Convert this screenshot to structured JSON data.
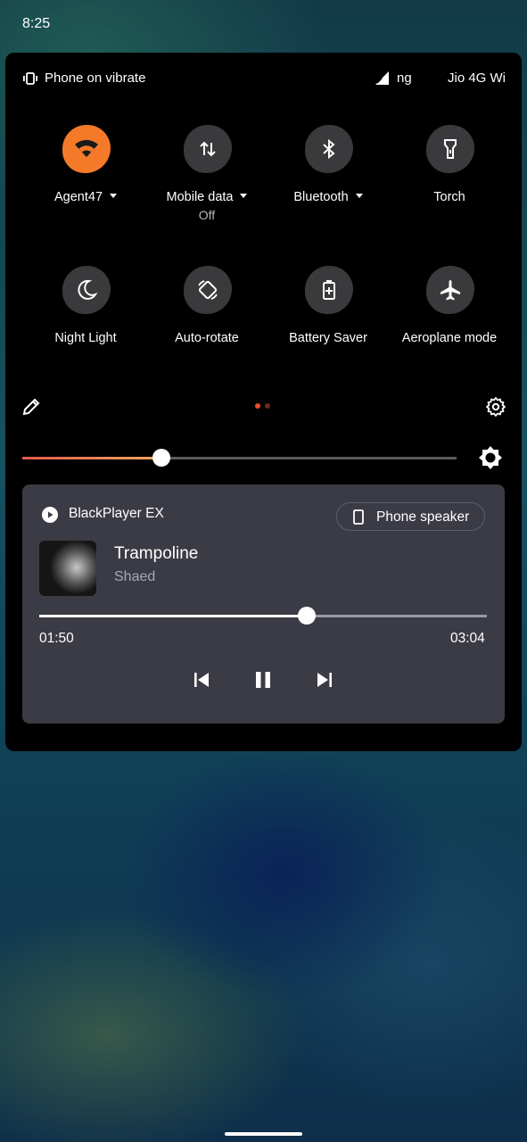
{
  "status_bar": {
    "time": "8:25"
  },
  "panel_header": {
    "ringer_label": "Phone on vibrate",
    "signal_text": "ng",
    "carrier": "Jio 4G Wi"
  },
  "tiles": [
    {
      "label": "Agent47",
      "sub": "",
      "has_dropdown": true,
      "active": true,
      "icon": "wifi-icon"
    },
    {
      "label": "Mobile data",
      "sub": "Off",
      "has_dropdown": true,
      "active": false,
      "icon": "mobile-data-icon"
    },
    {
      "label": "Bluetooth",
      "sub": "",
      "has_dropdown": true,
      "active": false,
      "icon": "bluetooth-icon"
    },
    {
      "label": "Torch",
      "sub": "",
      "has_dropdown": false,
      "active": false,
      "icon": "torch-icon"
    },
    {
      "label": "Night Light",
      "sub": "",
      "has_dropdown": false,
      "active": false,
      "icon": "moon-icon"
    },
    {
      "label": "Auto-rotate",
      "sub": "",
      "has_dropdown": false,
      "active": false,
      "icon": "rotate-icon"
    },
    {
      "label": "Battery Saver",
      "sub": "",
      "has_dropdown": false,
      "active": false,
      "icon": "battery-icon"
    },
    {
      "label": "Aeroplane mode",
      "sub": "",
      "has_dropdown": false,
      "active": false,
      "icon": "airplane-icon"
    }
  ],
  "pager": {
    "current_page": 1,
    "total_pages": 2
  },
  "brightness": {
    "level": 0.32
  },
  "media": {
    "app_name": "BlackPlayer EX",
    "output_device": "Phone speaker",
    "title": "Trampoline",
    "artist": "Shaed",
    "elapsed": "01:50",
    "duration": "03:04",
    "progress": 0.598
  },
  "colors": {
    "accent": "#f47a2a",
    "tile_inactive": "#3a3a3d",
    "panel_bg": "#000000",
    "media_card_bg": "#3b3b45",
    "page_dot_active": "#e8502a",
    "page_dot_inactive": "#6a2a20"
  }
}
